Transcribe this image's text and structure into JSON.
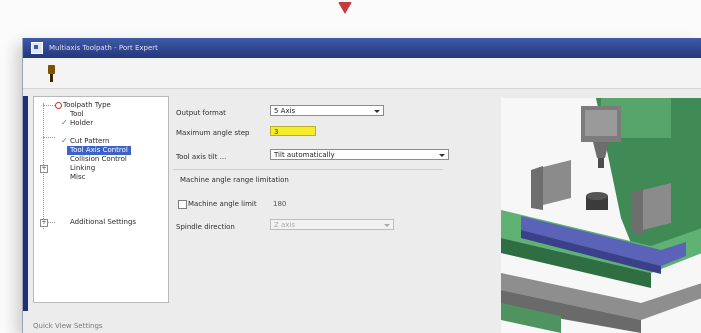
{
  "window": {
    "title": "Multiaxis Toolpath - Port Expert",
    "accent": "#2b3f8a"
  },
  "toolbar": {
    "tool_icon": "milling-tool-icon"
  },
  "tree": {
    "items": [
      {
        "label": "Toolpath Type",
        "icon": "error-circle-icon"
      },
      {
        "label": "Tool",
        "icon": ""
      },
      {
        "label": "Holder",
        "icon": "checkmark-icon"
      },
      {
        "label": "Cut Pattern",
        "icon": "checkmark-icon"
      },
      {
        "label": "Tool Axis Control",
        "icon": "",
        "selected": true
      },
      {
        "label": "Collision Control",
        "icon": ""
      },
      {
        "label": "Linking",
        "icon": "expand-plus-icon"
      },
      {
        "label": "Misc",
        "icon": ""
      },
      {
        "label": "Additional Settings",
        "icon": "expand-plus-icon"
      }
    ]
  },
  "form": {
    "output_format_label": "Output format",
    "output_format_value": "5 Axis",
    "max_angle_step_label": "Maximum angle step",
    "max_angle_step_value": "3",
    "tool_axis_limit_label": "Tool axis tilt ...",
    "tool_axis_limit_value": "Tilt automatically",
    "group_title": "Machine angle range limitation",
    "machine_angle_limit_label": "Machine angle limit",
    "machine_angle_limit_value": "180",
    "machine_angle_limit_checked": false,
    "spindle_direction_label": "Spindle direction",
    "spindle_direction_value": "Z axis"
  },
  "footer": {
    "quick_view_label": "Quick View Settings"
  }
}
